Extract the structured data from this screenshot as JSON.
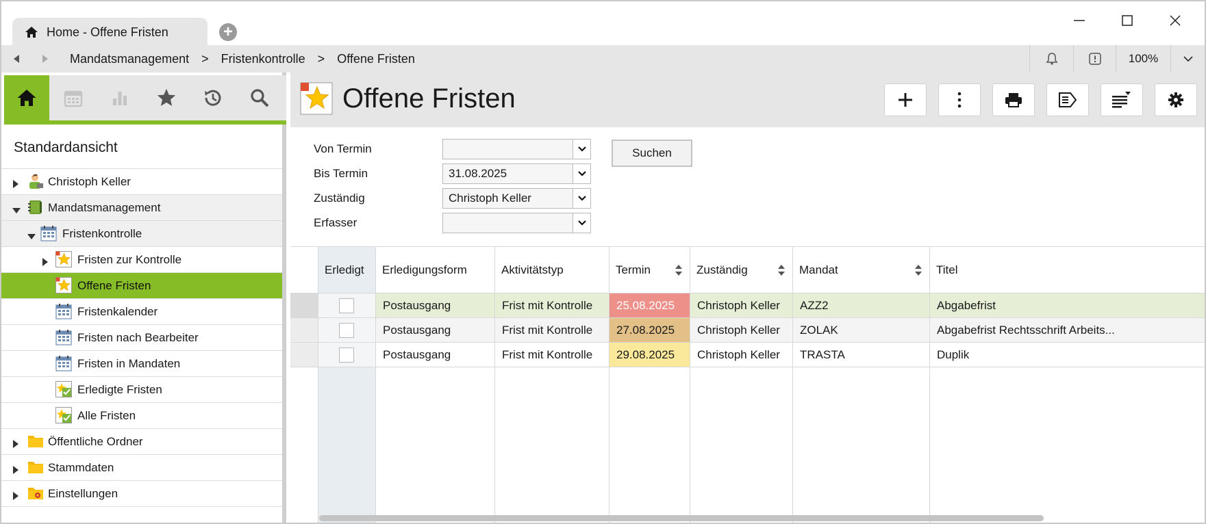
{
  "tab": {
    "title": "Home - Offene Fristen"
  },
  "breadcrumb": [
    "Mandatsmanagement",
    "Fristenkontrolle",
    "Offene Fristen"
  ],
  "breadcrumb_separator": ">",
  "zoom": "100%",
  "sidebar": {
    "title": "Standardansicht",
    "tree": [
      {
        "label": "Christoph Keller",
        "level": 0,
        "expand": "collapsed",
        "icon": "user-icon"
      },
      {
        "label": "Mandatsmanagement",
        "level": 0,
        "expand": "expanded",
        "icon": "book-icon"
      },
      {
        "label": "Fristenkontrolle",
        "level": 1,
        "expand": "expanded",
        "icon": "calendar-icon"
      },
      {
        "label": "Fristen zur Kontrolle",
        "level": 2,
        "expand": "collapsed",
        "icon": "star-icon"
      },
      {
        "label": "Offene Fristen",
        "level": 2,
        "expand": "none",
        "icon": "star-icon",
        "selected": true
      },
      {
        "label": "Fristenkalender",
        "level": 2,
        "expand": "none",
        "icon": "calendar-icon"
      },
      {
        "label": "Fristen nach Bearbeiter",
        "level": 2,
        "expand": "none",
        "icon": "calendar-icon"
      },
      {
        "label": "Fristen in Mandaten",
        "level": 2,
        "expand": "none",
        "icon": "calendar-icon"
      },
      {
        "label": "Erledigte Fristen",
        "level": 2,
        "expand": "none",
        "icon": "check-star-icon"
      },
      {
        "label": "Alle Fristen",
        "level": 2,
        "expand": "none",
        "icon": "check-star-icon"
      },
      {
        "label": "Öffentliche Ordner",
        "level": 0,
        "expand": "collapsed",
        "icon": "folder-icon"
      },
      {
        "label": "Stammdaten",
        "level": 0,
        "expand": "collapsed",
        "icon": "folder-icon"
      },
      {
        "label": "Einstellungen",
        "level": 0,
        "expand": "collapsed",
        "icon": "settings-folder-icon"
      }
    ]
  },
  "main": {
    "title": "Offene Fristen",
    "filters": [
      {
        "label": "Von Termin",
        "value": ""
      },
      {
        "label": "Bis Termin",
        "value": "31.08.2025"
      },
      {
        "label": "Zuständig",
        "value": "Christoph Keller"
      },
      {
        "label": "Erfasser",
        "value": ""
      }
    ],
    "search_label": "Suchen"
  },
  "table": {
    "columns": [
      "Erledigt",
      "Erledigungsform",
      "Aktivitätstyp",
      "Termin",
      "Zuständig",
      "Mandat",
      "Titel"
    ],
    "rows": [
      {
        "erledigungsform": "Postausgang",
        "aktivitaetstyp": "Frist mit Kontrolle",
        "termin": "25.08.2025",
        "zustaendig": "Christoph Keller",
        "mandat": "AZZ2",
        "titel": "Abgabefrist"
      },
      {
        "erledigungsform": "Postausgang",
        "aktivitaetstyp": "Frist mit Kontrolle",
        "termin": "27.08.2025",
        "zustaendig": "Christoph Keller",
        "mandat": "ZOLAK",
        "titel": "Abgabefrist Rechtsschrift Arbeits..."
      },
      {
        "erledigungsform": "Postausgang",
        "aktivitaetstyp": "Frist mit Kontrolle",
        "termin": "29.08.2025",
        "zustaendig": "Christoph Keller",
        "mandat": "TRASTA",
        "titel": "Duplik"
      }
    ]
  },
  "colors": {
    "accent": "#86bc25",
    "termin_overdue": "#ee908a",
    "termin_warning": "#e2c088",
    "termin_soon": "#fbe99b",
    "selected_row": "#e6efd6"
  }
}
